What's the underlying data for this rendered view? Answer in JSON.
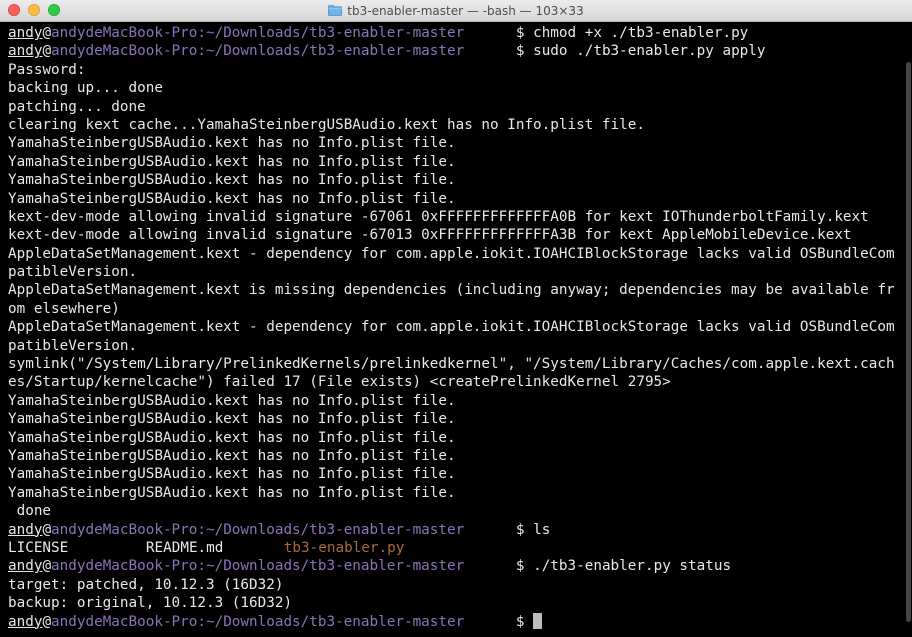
{
  "window": {
    "title": "tb3-enabler-master — -bash — 103×33"
  },
  "prompt": {
    "user": "andy",
    "at": "@",
    "host": "andydeMacBook-Pro",
    "sep": ":",
    "path": "~/Downloads/tb3-enabler-master",
    "gap": "      ",
    "dollar": "$ "
  },
  "lines": [
    {
      "kind": "prompt",
      "command": "chmod +x ./tb3-enabler.py"
    },
    {
      "kind": "prompt",
      "command": "sudo ./tb3-enabler.py apply"
    },
    {
      "kind": "out",
      "text": "Password:"
    },
    {
      "kind": "out",
      "text": "backing up... done"
    },
    {
      "kind": "out",
      "text": "patching... done"
    },
    {
      "kind": "out",
      "text": "clearing kext cache...YamahaSteinbergUSBAudio.kext has no Info.plist file."
    },
    {
      "kind": "out",
      "text": "YamahaSteinbergUSBAudio.kext has no Info.plist file."
    },
    {
      "kind": "out",
      "text": "YamahaSteinbergUSBAudio.kext has no Info.plist file."
    },
    {
      "kind": "out",
      "text": "YamahaSteinbergUSBAudio.kext has no Info.plist file."
    },
    {
      "kind": "out",
      "text": "YamahaSteinbergUSBAudio.kext has no Info.plist file."
    },
    {
      "kind": "out",
      "text": "kext-dev-mode allowing invalid signature -67061 0xFFFFFFFFFFFFFA0B for kext IOThunderboltFamily.kext"
    },
    {
      "kind": "out",
      "text": "kext-dev-mode allowing invalid signature -67013 0xFFFFFFFFFFFFFA3B for kext AppleMobileDevice.kext"
    },
    {
      "kind": "out",
      "text": "AppleDataSetManagement.kext - dependency for com.apple.iokit.IOAHCIBlockStorage lacks valid OSBundleCom"
    },
    {
      "kind": "out",
      "text": "patibleVersion."
    },
    {
      "kind": "out",
      "text": "AppleDataSetManagement.kext is missing dependencies (including anyway; dependencies may be available fr"
    },
    {
      "kind": "out",
      "text": "om elsewhere)"
    },
    {
      "kind": "out",
      "text": "AppleDataSetManagement.kext - dependency for com.apple.iokit.IOAHCIBlockStorage lacks valid OSBundleCom"
    },
    {
      "kind": "out",
      "text": "patibleVersion."
    },
    {
      "kind": "out",
      "text": "symlink(\"/System/Library/PrelinkedKernels/prelinkedkernel\", \"/System/Library/Caches/com.apple.kext.cach"
    },
    {
      "kind": "out",
      "text": "es/Startup/kernelcache\") failed 17 (File exists) <createPrelinkedKernel 2795>"
    },
    {
      "kind": "out",
      "text": "YamahaSteinbergUSBAudio.kext has no Info.plist file."
    },
    {
      "kind": "out",
      "text": "YamahaSteinbergUSBAudio.kext has no Info.plist file."
    },
    {
      "kind": "out",
      "text": "YamahaSteinbergUSBAudio.kext has no Info.plist file."
    },
    {
      "kind": "out",
      "text": "YamahaSteinbergUSBAudio.kext has no Info.plist file."
    },
    {
      "kind": "out",
      "text": "YamahaSteinbergUSBAudio.kext has no Info.plist file."
    },
    {
      "kind": "out",
      "text": "YamahaSteinbergUSBAudio.kext has no Info.plist file."
    },
    {
      "kind": "out",
      "text": " done"
    },
    {
      "kind": "prompt",
      "command": "ls"
    },
    {
      "kind": "ls",
      "items": [
        "LICENSE",
        "README.md",
        "tb3-enabler.py"
      ]
    },
    {
      "kind": "prompt",
      "command": "./tb3-enabler.py status"
    },
    {
      "kind": "out",
      "text": "target: patched, 10.12.3 (16D32)"
    },
    {
      "kind": "out",
      "text": "backup: original, 10.12.3 (16D32)"
    },
    {
      "kind": "prompt",
      "command": "",
      "cursor": true
    }
  ],
  "colors": {
    "background": "#000000",
    "text": "#e8e8e8",
    "prompt": "#8a73b8",
    "executable": "#a66a3b"
  }
}
